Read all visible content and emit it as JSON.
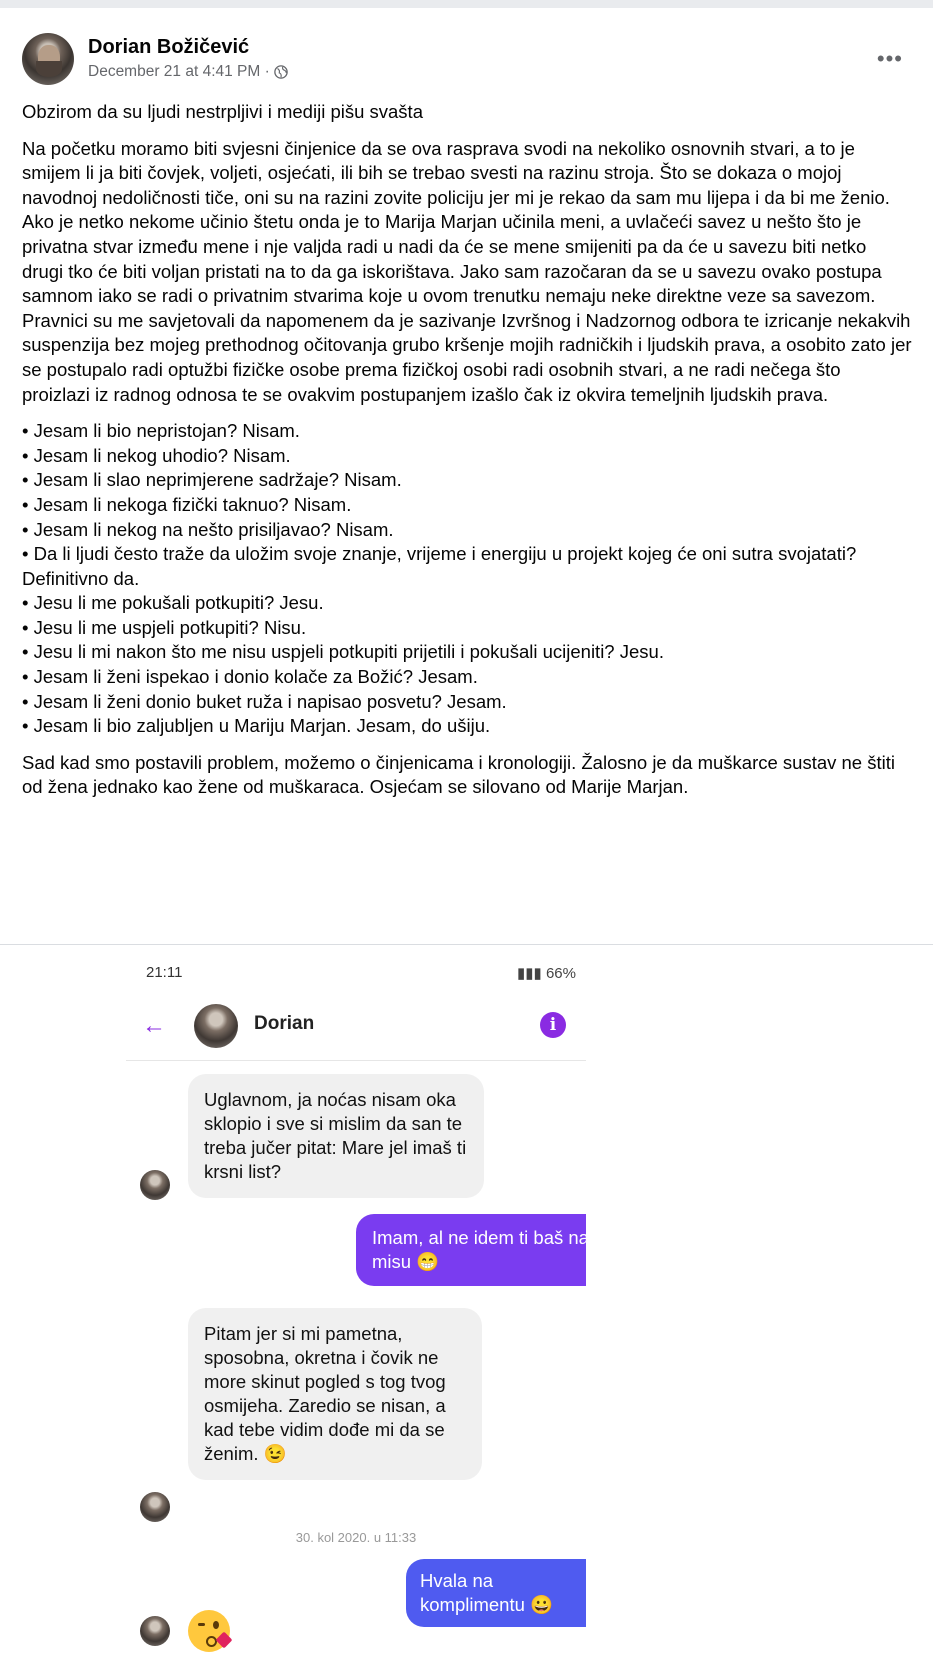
{
  "post": {
    "author": "Dorian Božičević",
    "date": "December 21 at 4:41 PM ·",
    "more": "•••",
    "paragraphs": [
      "Obzirom da su ljudi nestrpljivi i mediji pišu svašta",
      "Na početku moramo biti svjesni činjenice da se ova rasprava svodi na nekoliko osnovnih stvari, a to je smijem li ja biti čovjek, voljeti, osjećati, ili bih se trebao svesti na razinu stroja. Što se dokaza o mojoj navodnoj nedoličnosti tiče, oni su na razini zovite policiju jer mi je rekao da sam mu lijepa i da bi me ženio. Ako je netko nekome učinio štetu onda je to  Marija Marjan učinila meni, a uvlačeći savez u nešto što je privatna stvar između mene i nje valjda radi u nadi da će se mene smijeniti pa da će u savezu biti netko drugi tko će biti voljan pristati na to da ga iskorištava. Jako sam razočaran da se u savezu ovako postupa samnom iako se radi o privatnim stvarima koje u ovom trenutku nemaju neke direktne veze sa savezom. Pravnici su me savjetovali da napomenem da je sazivanje Izvršnog i Nadzornog odbora te izricanje nekakvih suspenzija bez mojeg prethodnog očitovanja grubo kršenje mojih radničkih i ljudskih prava, a osobito zato jer se postupalo radi optužbi fizičke osobe prema fizičkoj osobi radi osobnih stvari, a ne radi nečega što proizlazi iz radnog odnosa te se ovakvim postupanjem izašlo čak iz okvira temeljnih ljudskih prava."
    ],
    "bullets": [
      "Jesam li bio nepristojan? Nisam.",
      "Jesam li nekog uhodio? Nisam.",
      "Jesam li slao neprimjerene sadržaje? Nisam.",
      "Jesam li nekoga fizički taknuo? Nisam.",
      "Jesam li nekog na nešto prisiljavao? Nisam.",
      "Da li ljudi često traže da uložim svoje znanje, vrijeme i energiju u projekt kojeg će oni sutra svojatati? Definitivno da.",
      "Jesu li me pokušali potkupiti? Jesu.",
      "Jesu li me uspjeli potkupiti? Nisu.",
      "Jesu li mi nakon što me nisu uspjeli potkupiti prijetili i pokušali ucijeniti? Jesu.",
      "Jesam li ženi ispekao i donio kolače za Božić? Jesam.",
      "Jesam li ženi donio buket ruža i napisao posvetu? Jesam.",
      "Jesam li bio zaljubljen u Mariju Marjan. Jesam, do ušiju."
    ],
    "closing": "Sad kad smo postavili problem, možemo o činjenicama i kronologiji. Žalosno je da muškarce sustav ne štiti od žena jednako kao žene od muškaraca. Osjećam se silovano od Marije Marjan."
  },
  "screenshot": {
    "status_time": "21:11",
    "status_right": "66%",
    "chat_name": "Dorian",
    "info_icon": "i",
    "messages": [
      {
        "text": "Uglavnom, ja noćas nisam oka sklopio i sve si mislim da san te treba jučer pitat: Mare jel imaš ti krsni list?"
      },
      {
        "text": "Imam, al ne idem ti baš na misu 😁"
      },
      {
        "text": "Pitam jer si mi pametna, sposobna, okretna i čovik ne more skinut pogled s tog tvog osmijeha. Zaredio se nisan, a kad tebe vidim dođe mi da se ženim. 😉"
      },
      {
        "text": "Hvala na komplimentu 😀"
      }
    ],
    "timestamp": "30. kol 2020. u 11:33"
  },
  "colors": {
    "outgoing": "#7a3cf0",
    "outgoing_alt": "#4f5bf0",
    "incoming": "#f0f0f0",
    "accent": "#8a2be2"
  }
}
